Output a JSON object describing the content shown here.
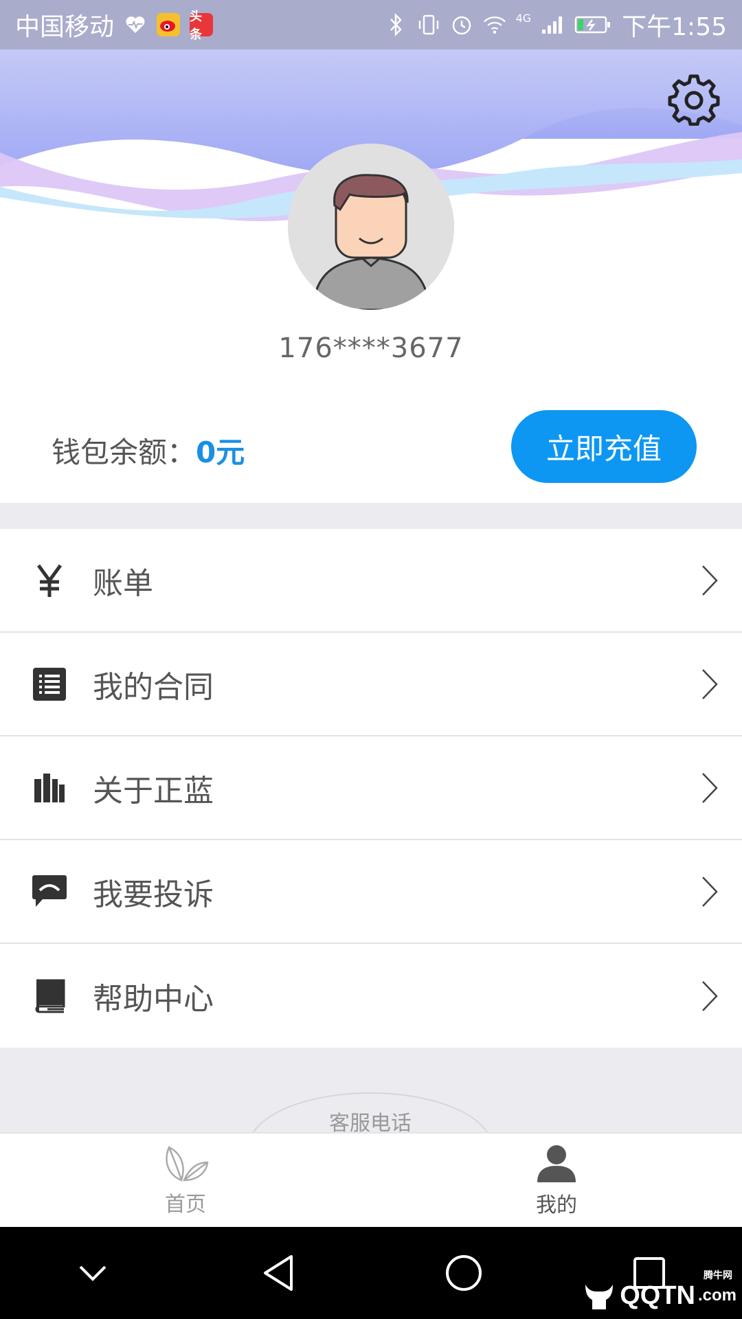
{
  "status_bar": {
    "carrier": "中国移动",
    "toutiao_badge": "头条",
    "network": "4G",
    "time": "下午1:55"
  },
  "profile": {
    "phone": "176****3677"
  },
  "wallet": {
    "label": "钱包余额：",
    "amount": "0元",
    "recharge_label": "立即充值"
  },
  "menu": {
    "items": [
      {
        "label": "账单",
        "icon": "yen-icon"
      },
      {
        "label": "我的合同",
        "icon": "contract-list-icon"
      },
      {
        "label": "关于正蓝",
        "icon": "bar-chart-icon"
      },
      {
        "label": "我要投诉",
        "icon": "chat-bubble-icon"
      },
      {
        "label": "帮助中心",
        "icon": "book-icon"
      }
    ]
  },
  "service": {
    "label": "客服电话"
  },
  "tabbar": {
    "tabs": [
      {
        "label": "首页",
        "icon": "leaf-icon",
        "active": false
      },
      {
        "label": "我的",
        "icon": "person-icon",
        "active": true
      }
    ]
  },
  "watermark": {
    "brand": "QQTN",
    "suffix": ".com",
    "small_text": "腾牛网"
  },
  "colors": {
    "accent": "#0d97f2",
    "status_bar": "#a9accb",
    "wave_blue": "#a6b4f5",
    "wave_purple": "#dcc6f7",
    "wave_cyan": "#c6e6fb"
  }
}
